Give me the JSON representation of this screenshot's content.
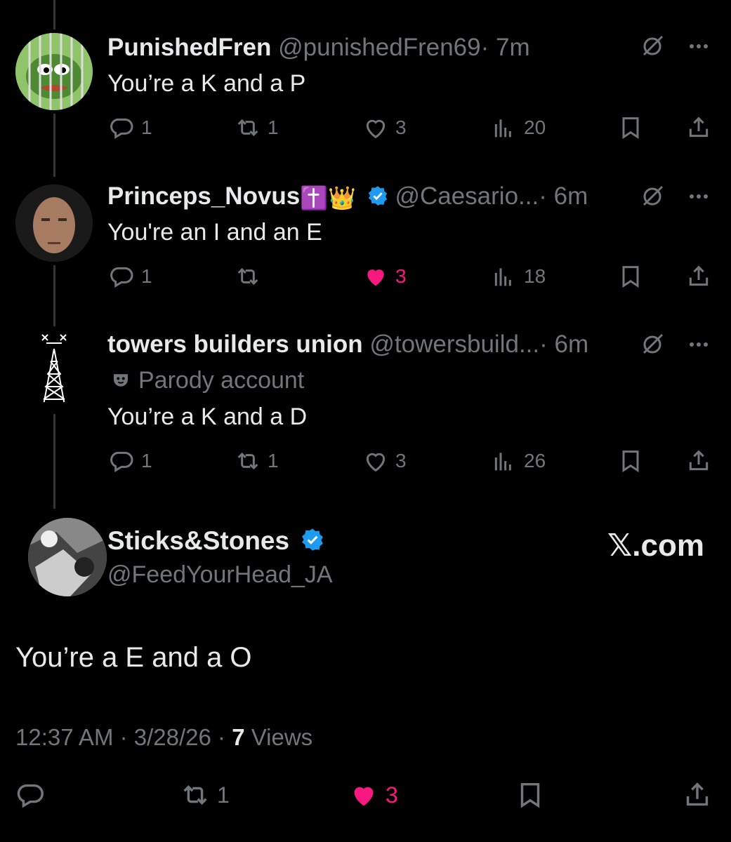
{
  "replies": [
    {
      "name": "PunishedFren",
      "handle": "@punishedFren69",
      "time": "· 7m",
      "text": "You’re a K and a P",
      "stats": {
        "replies": "1",
        "reposts": "1",
        "likes": "3",
        "views": "20"
      },
      "liked": false
    },
    {
      "name": "Princeps_Novus",
      "emojis": "✝️👑",
      "handle": "@Caesario...",
      "time": "· 6m",
      "text": "You're an I and an E",
      "stats": {
        "replies": "1",
        "reposts": "",
        "likes": "3",
        "views": "18"
      },
      "liked": true
    },
    {
      "name": "towers builders union",
      "handle": "@towersbuild...",
      "time": "· 6m",
      "parody_label": "Parody account",
      "text": "You’re a K and a D",
      "stats": {
        "replies": "1",
        "reposts": "1",
        "likes": "3",
        "views": "26"
      },
      "liked": false
    }
  ],
  "main_post": {
    "name": "Sticks&Stones",
    "handle": "@FeedYourHead_JA",
    "site": "𝕏.com",
    "text": "You’re a E and a O",
    "time": "12:37 AM · 3/28/26 · ",
    "views_count": "7",
    "views_label": " Views",
    "reposts": "1",
    "likes": "3"
  },
  "colors": {
    "background": "#000000",
    "text": "#e7e9ea",
    "muted": "#71767b",
    "like": "#f91880",
    "verified": "#1d9bf0"
  }
}
